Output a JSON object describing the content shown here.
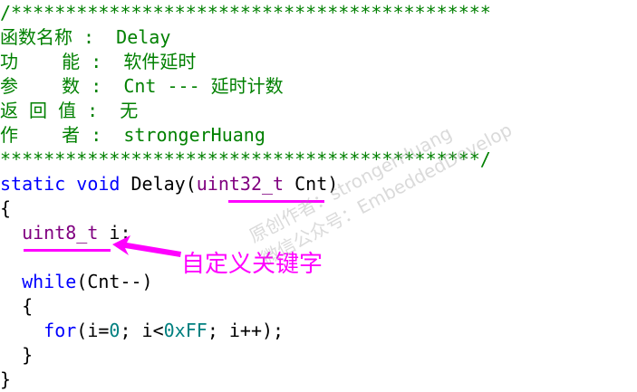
{
  "code": {
    "lines": [
      {
        "parts": [
          {
            "c": "cm",
            "t": "/********************************************"
          }
        ]
      },
      {
        "parts": [
          {
            "c": "cm",
            "t": "函数名称 :  Delay"
          }
        ]
      },
      {
        "parts": [
          {
            "c": "cm",
            "t": "功    能 :  软件延时"
          }
        ]
      },
      {
        "parts": [
          {
            "c": "cm",
            "t": "参    数 :  Cnt --- 延时计数"
          }
        ]
      },
      {
        "parts": [
          {
            "c": "cm",
            "t": "返 回 值 :  无"
          }
        ]
      },
      {
        "parts": [
          {
            "c": "cm",
            "t": "作    者 :  strongerHuang"
          }
        ]
      },
      {
        "parts": [
          {
            "c": "cm",
            "t": "********************************************/"
          }
        ]
      },
      {
        "parts": [
          {
            "c": "kw",
            "t": "static"
          },
          {
            "c": "blk",
            "t": " "
          },
          {
            "c": "kw",
            "t": "void"
          },
          {
            "c": "blk",
            "t": " Delay("
          },
          {
            "c": "ty",
            "t": "uint32_t"
          },
          {
            "c": "blk",
            "t": " Cnt)"
          }
        ]
      },
      {
        "parts": [
          {
            "c": "blk",
            "t": "{"
          }
        ]
      },
      {
        "parts": [
          {
            "c": "blk",
            "t": "  "
          },
          {
            "c": "ty",
            "t": "uint8_t"
          },
          {
            "c": "blk",
            "t": " i;"
          }
        ]
      },
      {
        "parts": [
          {
            "c": "blk",
            "t": ""
          }
        ]
      },
      {
        "parts": [
          {
            "c": "blk",
            "t": "  "
          },
          {
            "c": "kw",
            "t": "while"
          },
          {
            "c": "blk",
            "t": "(Cnt--)"
          }
        ]
      },
      {
        "parts": [
          {
            "c": "blk",
            "t": "  {"
          }
        ]
      },
      {
        "parts": [
          {
            "c": "blk",
            "t": "    "
          },
          {
            "c": "kw",
            "t": "for"
          },
          {
            "c": "blk",
            "t": "(i="
          },
          {
            "c": "num",
            "t": "0"
          },
          {
            "c": "blk",
            "t": "; i<"
          },
          {
            "c": "num",
            "t": "0xFF"
          },
          {
            "c": "blk",
            "t": "; i++);"
          }
        ]
      },
      {
        "parts": [
          {
            "c": "blk",
            "t": "  }"
          }
        ]
      },
      {
        "parts": [
          {
            "c": "blk",
            "t": "}"
          }
        ]
      }
    ]
  },
  "annotation": {
    "label": "自定义关键字",
    "color": "#ff00ff"
  },
  "watermark": {
    "line1": "原创作者：strongerHuang",
    "line2": "微信公众号：EmbeddedDevelop"
  }
}
